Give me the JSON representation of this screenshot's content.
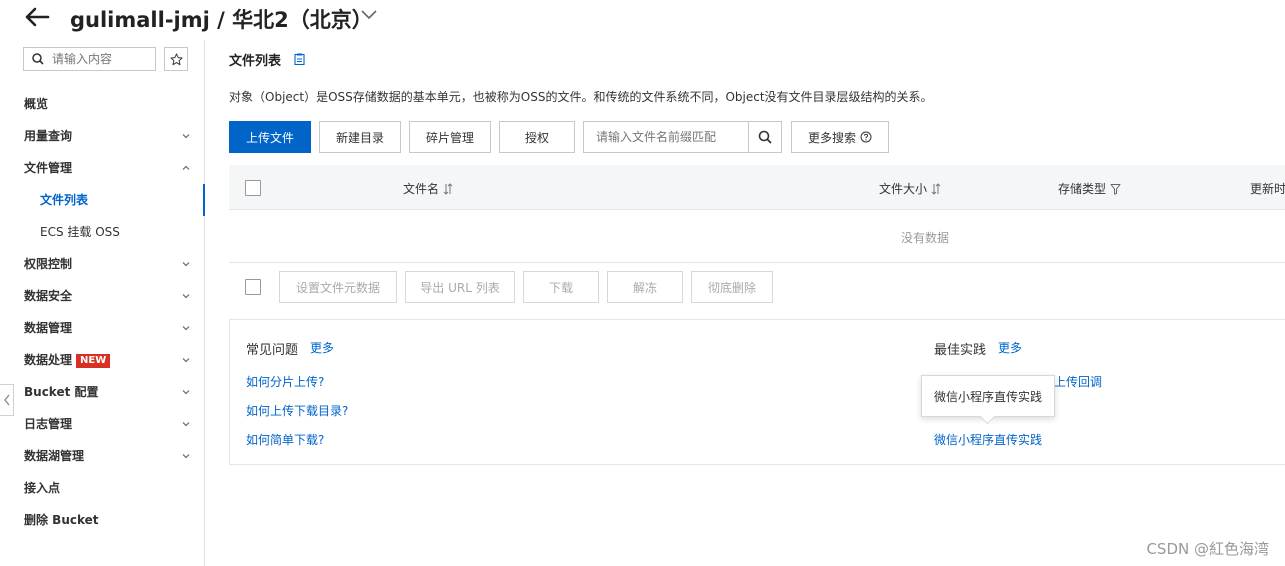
{
  "header": {
    "title": "gulimall-jmj / 华北2（北京）"
  },
  "sidebar": {
    "search_placeholder": "请输入内容",
    "items": [
      {
        "label": "概览"
      },
      {
        "label": "用量查询"
      },
      {
        "label": "文件管理"
      },
      {
        "label": "文件列表"
      },
      {
        "label": "ECS 挂载 OSS"
      },
      {
        "label": "权限控制"
      },
      {
        "label": "数据安全"
      },
      {
        "label": "数据管理"
      },
      {
        "label": "数据处理",
        "badge": "NEW"
      },
      {
        "label": "Bucket 配置"
      },
      {
        "label": "日志管理"
      },
      {
        "label": "数据湖管理"
      },
      {
        "label": "接入点"
      },
      {
        "label": "删除 Bucket"
      }
    ]
  },
  "main": {
    "page_title": "文件列表",
    "description": "对象（Object）是OSS存储数据的基本单元，也被称为OSS的文件。和传统的文件系统不同，Object没有文件目录层级结构的关系。",
    "toolbar": {
      "upload": "上传文件",
      "new_dir": "新建目录",
      "fragments": "碎片管理",
      "authorize": "授权",
      "search_placeholder": "请输入文件名前缀匹配",
      "more_search": "更多搜索"
    },
    "table": {
      "columns": [
        "文件名",
        "文件大小",
        "存储类型",
        "更新时间"
      ],
      "empty_text": "没有数据"
    },
    "bulk": {
      "set_meta": "设置文件元数据",
      "export_url": "导出 URL 列表",
      "download": "下载",
      "unfreeze": "解冻",
      "delete": "彻底删除"
    },
    "faq": {
      "title": "常见问题",
      "more": "更多",
      "links": [
        "如何分片上传?",
        "如何上传下载目录?",
        "如何简单下载?"
      ]
    },
    "best_practice": {
      "title": "最佳实践",
      "more": "更多",
      "link1_partial": "上传回调",
      "link3": "微信小程序直传实践"
    },
    "tooltip": "微信小程序直传实践"
  },
  "watermark": "CSDN @紅色海湾",
  "colors": {
    "primary": "#0064c8",
    "new_badge": "#d93026"
  }
}
